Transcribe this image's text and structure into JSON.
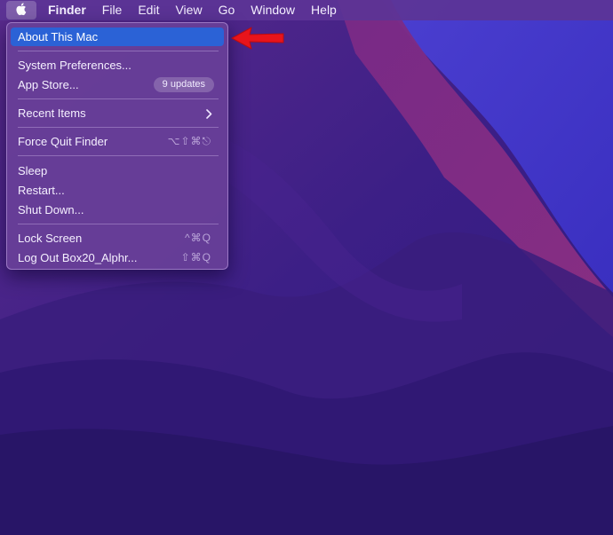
{
  "menubar": {
    "apple_icon": "apple-logo-icon",
    "items": [
      {
        "label": "Finder",
        "bold": true
      },
      {
        "label": "File"
      },
      {
        "label": "Edit"
      },
      {
        "label": "View"
      },
      {
        "label": "Go"
      },
      {
        "label": "Window"
      },
      {
        "label": "Help"
      }
    ]
  },
  "apple_menu": {
    "items": [
      {
        "label": "About This Mac",
        "active": true
      },
      {
        "label": "System Preferences..."
      },
      {
        "label": "App Store...",
        "badge": "9 updates"
      },
      {
        "label": "Recent Items",
        "submenu_icon": "chevron-right-icon"
      },
      {
        "label": "Force Quit Finder",
        "shortcut": "⌥⇧⌘⎋"
      },
      {
        "label": "Sleep"
      },
      {
        "label": "Restart..."
      },
      {
        "label": "Shut Down..."
      },
      {
        "label": "Lock Screen",
        "shortcut": "^⌘Q"
      },
      {
        "label": "Log Out Box20_Alphr...",
        "shortcut": "⇧⌘Q"
      }
    ]
  },
  "annotation": {
    "arrow_color": "#e8141b",
    "icon": "left-arrow-icon"
  },
  "colors": {
    "menu_highlight": "#2b62d6",
    "wallpaper_base": "#3a1f8a"
  }
}
